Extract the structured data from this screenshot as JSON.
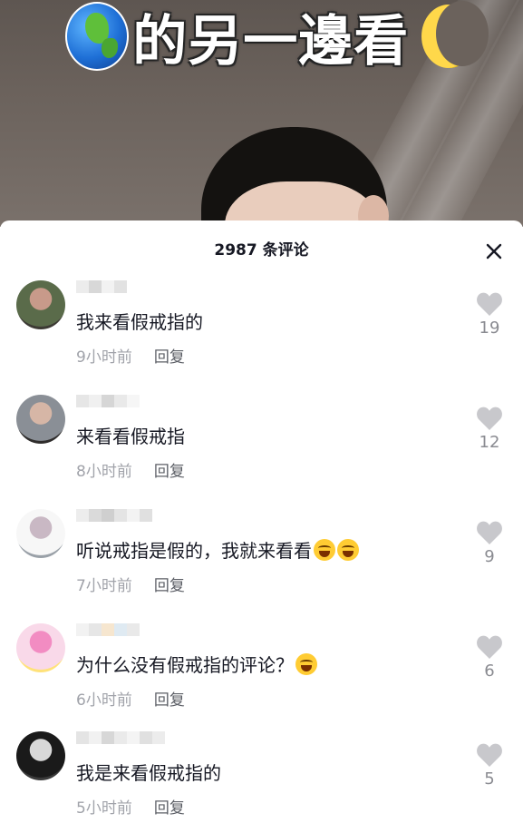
{
  "video": {
    "overlay_title": "的另一邊看",
    "icons": [
      "globe-icon",
      "moon-icon"
    ]
  },
  "sheet": {
    "comment_count": "2987 条评论",
    "close_icon": "close-icon"
  },
  "comments": [
    {
      "text": "我来看假戒指的",
      "time": "9小时前",
      "reply_label": "回复",
      "likes": "19",
      "avatar_colors": [
        "#5a6b4a",
        "#c89a8a",
        "#3c3a34"
      ],
      "mosaic": [
        "#ececec",
        "#d8d8d8",
        "#f2f2f2",
        "#e2e2e2",
        "#ffffff"
      ],
      "emojis": 0
    },
    {
      "text": "来看看假戒指",
      "time": "8小时前",
      "reply_label": "回复",
      "likes": "12",
      "avatar_colors": [
        "#8a8f96",
        "#d6b6a6",
        "#2e2c2b"
      ],
      "mosaic": [
        "#e6e6e6",
        "#f0f0f0",
        "#d6d6d6",
        "#e9e9e9",
        "#f6f6f6"
      ],
      "emojis": 0
    },
    {
      "text": "听说戒指是假的，我就来看看",
      "time": "7小时前",
      "reply_label": "回复",
      "likes": "9",
      "avatar_colors": [
        "#f7f7f7",
        "#c9b8c4",
        "#9aa1a8"
      ],
      "mosaic": [
        "#ededed",
        "#dadada",
        "#cfcfcf",
        "#e4e4e4",
        "#f3f3f3",
        "#e0e0e0"
      ],
      "emojis": 2
    },
    {
      "text": "为什么没有假戒指的评论？",
      "time": "6小时前",
      "reply_label": "回复",
      "likes": "6",
      "avatar_colors": [
        "#f9d9e9",
        "#f28cc2",
        "#ffe27a"
      ],
      "mosaic": [
        "#f2f2f2",
        "#e6e6e6",
        "#f6e6cf",
        "#dfeaf2",
        "#e9e9e9"
      ],
      "emojis": 1
    },
    {
      "text": "我是来看假戒指的",
      "time": "5小时前",
      "reply_label": "回复",
      "likes": "5",
      "avatar_colors": [
        "#1a1a1a",
        "#d8d8d8",
        "#3a3a3a"
      ],
      "mosaic": [
        "#e4e4e4",
        "#f1f1f1",
        "#d7d7d7",
        "#eaeaea",
        "#f4f4f4",
        "#e0e0e0",
        "#ececec"
      ],
      "emojis": 0
    }
  ],
  "colors": {
    "text_primary": "#161823",
    "text_secondary": "#a1a3aa",
    "heart": "#c8c8cc"
  }
}
